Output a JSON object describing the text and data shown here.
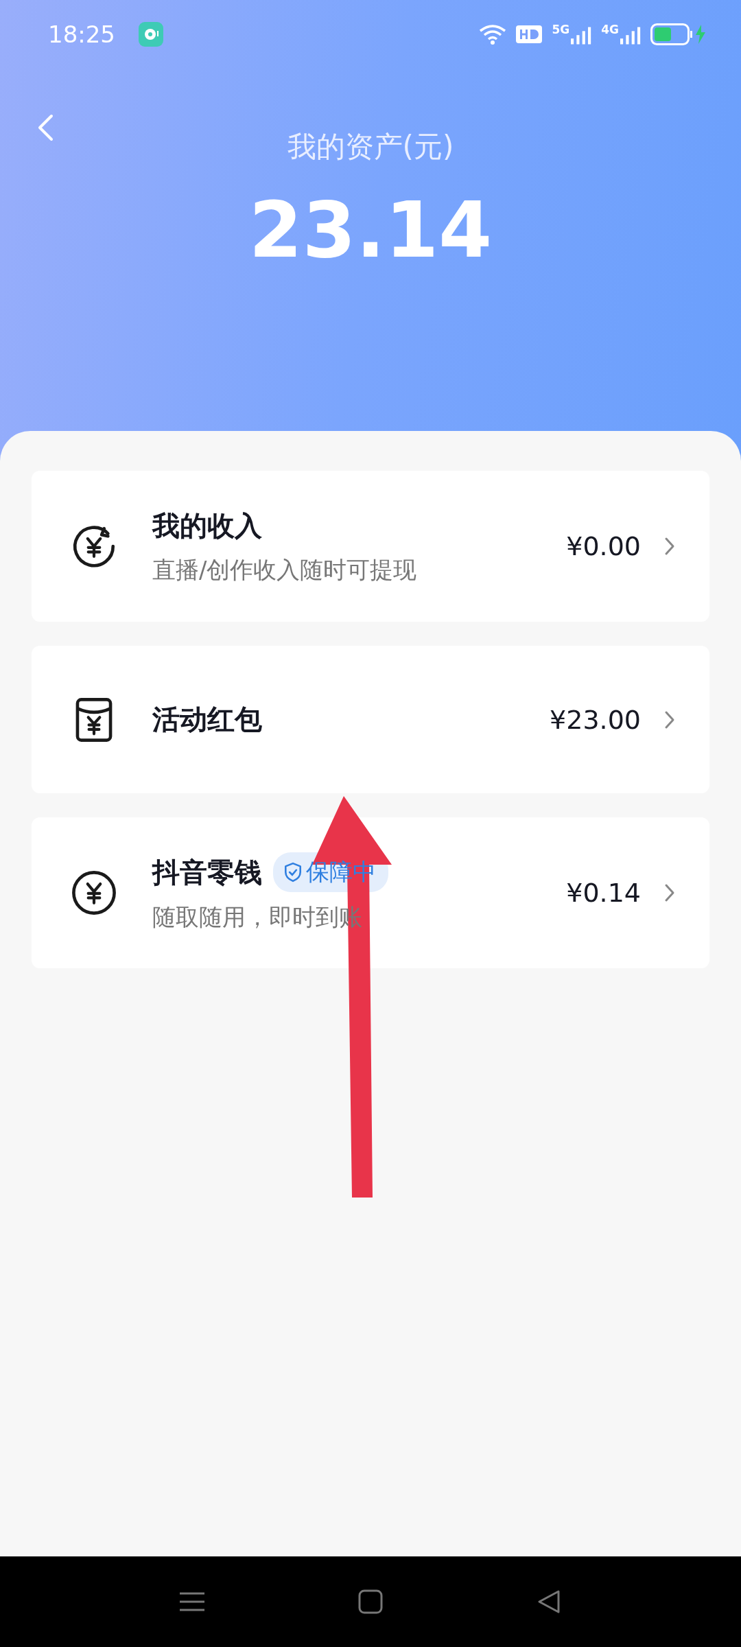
{
  "status_bar": {
    "time": "18:25",
    "network_labels": [
      "5G",
      "4G"
    ]
  },
  "header": {
    "title": "我的资产(元)",
    "amount": "23.14"
  },
  "items": [
    {
      "kind": "income",
      "title": "我的收入",
      "subtitle": "直播/创作收入随时可提现",
      "amount": "¥0.00"
    },
    {
      "kind": "red_packet",
      "title": "活动红包",
      "amount": "¥23.00"
    },
    {
      "kind": "change",
      "title": "抖音零钱",
      "badge": "保障中",
      "subtitle": "随取随用，即时到账",
      "amount": "¥0.14"
    }
  ]
}
